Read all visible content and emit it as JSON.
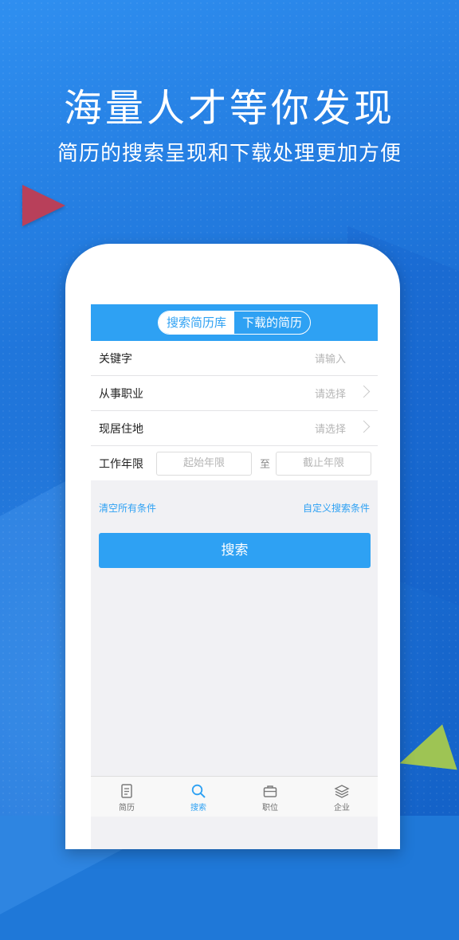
{
  "promo": {
    "headline": "海量人才等你发现",
    "subheadline": "简历的搜索呈现和下载处理更加方便"
  },
  "segments": {
    "active": "搜索简历库",
    "inactive": "下载的简历"
  },
  "form": {
    "keyword": {
      "label": "关键字",
      "placeholder": "请输入"
    },
    "occupation": {
      "label": "从事职业",
      "placeholder": "请选择"
    },
    "residence": {
      "label": "现居住地",
      "placeholder": "请选择"
    },
    "work_years": {
      "label": "工作年限",
      "start_placeholder": "起始年限",
      "separator": "至",
      "end_placeholder": "截止年限"
    }
  },
  "actions": {
    "clear": "清空所有条件",
    "custom": "自定义搜索条件",
    "search": "搜索"
  },
  "tabbar": [
    {
      "label": "简历",
      "icon": "resume-icon"
    },
    {
      "label": "搜索",
      "icon": "search-icon"
    },
    {
      "label": "职位",
      "icon": "briefcase-icon"
    },
    {
      "label": "企业",
      "icon": "layers-icon"
    }
  ],
  "colors": {
    "accent": "#2ea1f3",
    "background": "#1c70d6"
  }
}
